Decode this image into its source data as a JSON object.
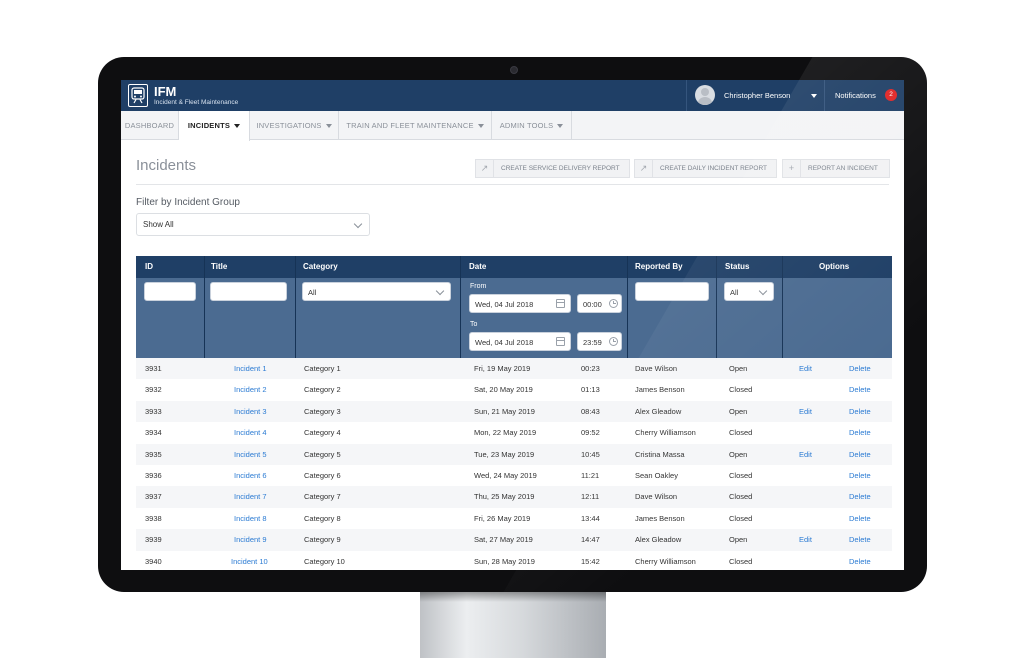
{
  "header": {
    "brand": "IFM",
    "brand_subtitle": "Incident & Fleet Maintenance",
    "user_name": "Christopher Benson",
    "notifications_label": "Notifications",
    "notifications_count": "2"
  },
  "nav": {
    "items": [
      {
        "label": "DASHBOARD"
      },
      {
        "label": "INCIDENTS"
      },
      {
        "label": "INVESTIGATIONS"
      },
      {
        "label": "TRAIN AND FLEET MAINTENANCE"
      },
      {
        "label": "ADMIN TOOLS"
      }
    ],
    "active": "INCIDENTS"
  },
  "page": {
    "title": "Incidents",
    "actions": [
      {
        "label": "CREATE SERVICE DELIVERY REPORT",
        "icon": "share-icon"
      },
      {
        "label": "CREATE DAILY INCIDENT REPORT",
        "icon": "share-icon"
      },
      {
        "label": "REPORT AN INCIDENT",
        "icon": "plus-icon"
      }
    ]
  },
  "filter": {
    "label": "Filter by Incident Group",
    "value": "Show All"
  },
  "table": {
    "columns": [
      "ID",
      "Title",
      "Category",
      "Date",
      "Reported By",
      "Status",
      "Options"
    ],
    "filters": {
      "category": "All",
      "from_label": "From",
      "from_date": "Wed, 04 Jul 2018",
      "from_time": "00:00",
      "to_label": "To",
      "to_date": "Wed, 04 Jul 2018",
      "to_time": "23:59",
      "status": "All"
    },
    "rows": [
      {
        "id": "3931",
        "title": "Incident 1",
        "category": "Category 1",
        "date": "Fri, 19 May 2019",
        "time": "00:23",
        "reporter": "Dave Wilson",
        "status": "Open",
        "edit": "Edit",
        "delete": "Delete"
      },
      {
        "id": "3932",
        "title": "Incident 2",
        "category": "Category 2",
        "date": "Sat, 20 May 2019",
        "time": "01:13",
        "reporter": "James Benson",
        "status": "Closed",
        "edit": "",
        "delete": "Delete"
      },
      {
        "id": "3933",
        "title": "Incident 3",
        "category": "Category 3",
        "date": "Sun, 21 May 2019",
        "time": "08:43",
        "reporter": "Alex Gleadow",
        "status": "Open",
        "edit": "Edit",
        "delete": "Delete"
      },
      {
        "id": "3934",
        "title": "Incident 4",
        "category": "Category 4",
        "date": "Mon, 22 May 2019",
        "time": "09:52",
        "reporter": "Cherry Williamson",
        "status": "Closed",
        "edit": "",
        "delete": "Delete"
      },
      {
        "id": "3935",
        "title": "Incident 5",
        "category": "Category 5",
        "date": "Tue, 23 May 2019",
        "time": "10:45",
        "reporter": "Cristina Massa",
        "status": "Open",
        "edit": "Edit",
        "delete": "Delete"
      },
      {
        "id": "3936",
        "title": "Incident 6",
        "category": "Category 6",
        "date": "Wed, 24 May 2019",
        "time": "11:21",
        "reporter": "Sean Oakley",
        "status": "Closed",
        "edit": "",
        "delete": "Delete"
      },
      {
        "id": "3937",
        "title": "Incident 7",
        "category": "Category 7",
        "date": "Thu, 25 May 2019",
        "time": "12:11",
        "reporter": "Dave Wilson",
        "status": "Closed",
        "edit": "",
        "delete": "Delete"
      },
      {
        "id": "3938",
        "title": "Incident 8",
        "category": "Category 8",
        "date": "Fri, 26 May 2019",
        "time": "13:44",
        "reporter": "James Benson",
        "status": "Closed",
        "edit": "",
        "delete": "Delete"
      },
      {
        "id": "3939",
        "title": "Incident 9",
        "category": "Category 9",
        "date": "Sat, 27 May 2019",
        "time": "14:47",
        "reporter": "Alex Gleadow",
        "status": "Open",
        "edit": "Edit",
        "delete": "Delete"
      },
      {
        "id": "3940",
        "title": "Incident 10",
        "category": "Category 10",
        "date": "Sun, 28 May 2019",
        "time": "15:42",
        "reporter": "Cherry Williamson",
        "status": "Closed",
        "edit": "",
        "delete": "Delete"
      }
    ]
  },
  "colors": {
    "header_bg": "#1f3f66",
    "table_filter_bg": "#4b6b91",
    "link": "#2b7bd3",
    "badge": "#e02424"
  }
}
